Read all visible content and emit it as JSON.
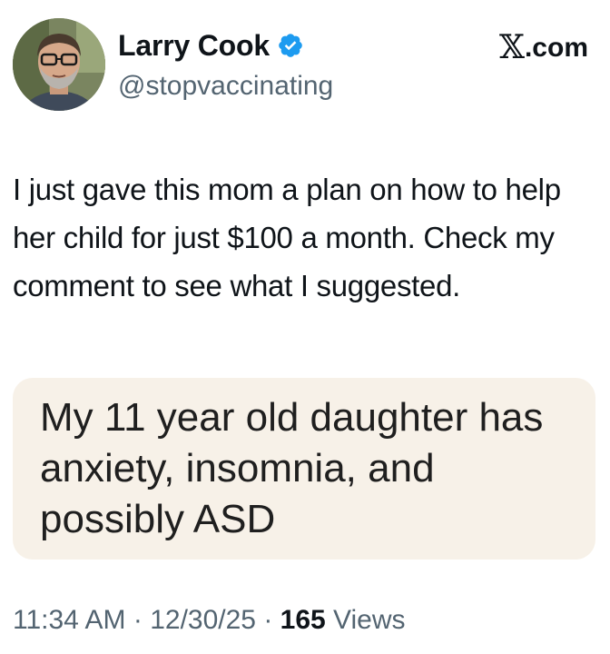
{
  "author": {
    "display_name": "Larry Cook",
    "handle": "@stopvaccinating",
    "verified_icon": "verified-badge-icon",
    "avatar_icon": "profile-photo-icon"
  },
  "brand": {
    "glyph": "𝕏",
    "suffix": ".com"
  },
  "tweet": {
    "text": "I just gave this mom a plan on how to help her child for just $100 a month. Check my comment to see what I suggested."
  },
  "quoted_image": {
    "text": "My 11 year old daughter has anxiety, insomnia, and possibly ASD"
  },
  "meta": {
    "time": "11:34 AM",
    "separator1": " · ",
    "date": "12/30/25",
    "separator2": " · ",
    "views_count": "165",
    "views_label": " Views"
  },
  "colors": {
    "verified_blue": "#1d9bf0",
    "secondary_text": "#536471",
    "primary_text": "#0f1419",
    "card_background": "#f7f1e8"
  }
}
